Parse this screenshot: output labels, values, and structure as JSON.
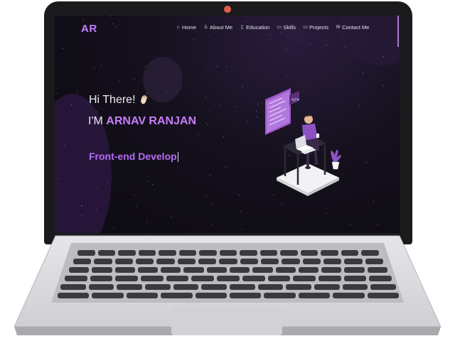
{
  "site": {
    "logo": "AR",
    "nav": [
      {
        "label": "Home",
        "icon": "home-icon",
        "glyph": "⌂"
      },
      {
        "label": "About Me",
        "icon": "user-icon",
        "glyph": "♙"
      },
      {
        "label": "Education",
        "icon": "book-icon",
        "glyph": "▯"
      },
      {
        "label": "Skills",
        "icon": "laptop-icon",
        "glyph": "▭"
      },
      {
        "label": "Projects",
        "icon": "laptop-code-icon",
        "glyph": "▭"
      },
      {
        "label": "Contact Me",
        "icon": "envelope-icon",
        "glyph": "✉"
      }
    ]
  },
  "hero": {
    "greeting": "Hi There!",
    "wave_icon": "waving-hand-icon",
    "intro_prefix": "I'M",
    "name": "ARNAV RANJAN",
    "typed_role": "Front-end Develop"
  },
  "colors": {
    "accent": "#c77dff",
    "role": "#b46cf2",
    "camera": "#e0604d"
  }
}
